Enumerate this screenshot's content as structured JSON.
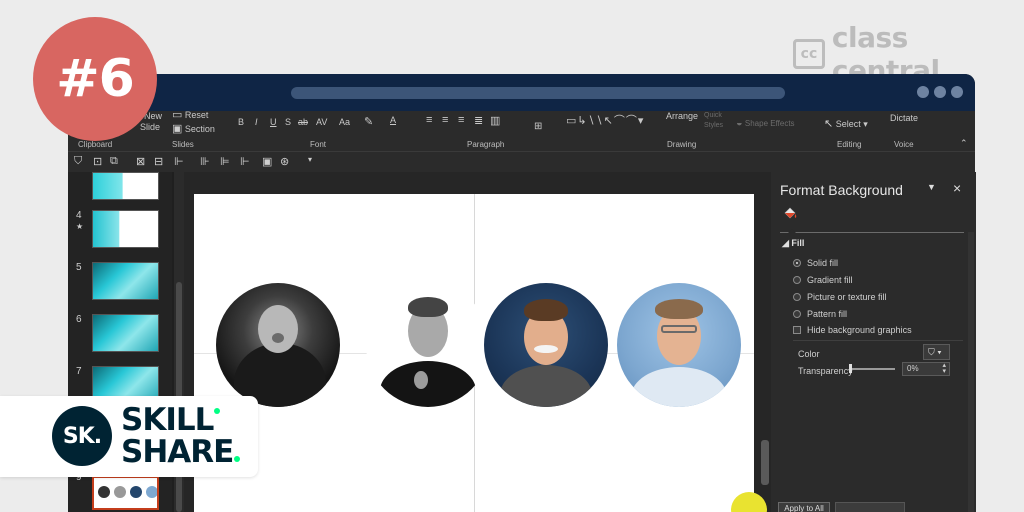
{
  "watermark": {
    "cc_mark": "cc",
    "text": "class central"
  },
  "badge": {
    "text": "#6"
  },
  "skillshare": {
    "mark": "SK.",
    "line1": "SKILL",
    "line2": "SHARE"
  },
  "ribbon": {
    "new_slide_top": "New",
    "new_slide_bottom": "Slide",
    "reset": "Reset",
    "section": "Section",
    "font_buttons": [
      "B",
      "I",
      "U",
      "S",
      "ab",
      "AV",
      "Aa",
      "A"
    ],
    "arrange": "Arrange",
    "quick_styles": "Quick Styles",
    "shape_effects": "Shape Effects",
    "select": "Select",
    "dictate": "Dictate",
    "groups": {
      "clipboard": "Clipboard",
      "slides": "Slides",
      "font": "Font",
      "paragraph": "Paragraph",
      "drawing": "Drawing",
      "editing": "Editing",
      "voice": "Voice"
    }
  },
  "thumbnails": [
    {
      "number": "4",
      "star": "★"
    },
    {
      "number": "5",
      "star": ""
    },
    {
      "number": "6",
      "star": ""
    },
    {
      "number": "7",
      "star": ""
    },
    {
      "number": "9",
      "star": ""
    }
  ],
  "format_pane": {
    "title": "Format Background",
    "section": "Fill",
    "options": [
      {
        "label": "Solid fill",
        "type": "radio",
        "selected": true
      },
      {
        "label": "Gradient fill",
        "type": "radio",
        "selected": false
      },
      {
        "label": "Picture or texture fill",
        "type": "radio",
        "selected": false
      },
      {
        "label": "Pattern fill",
        "type": "radio",
        "selected": false
      },
      {
        "label": "Hide background graphics",
        "type": "checkbox",
        "selected": false
      }
    ],
    "color_label": "Color",
    "transparency_label": "Transparency",
    "transparency_value": "0%",
    "apply_all": "Apply to All"
  }
}
